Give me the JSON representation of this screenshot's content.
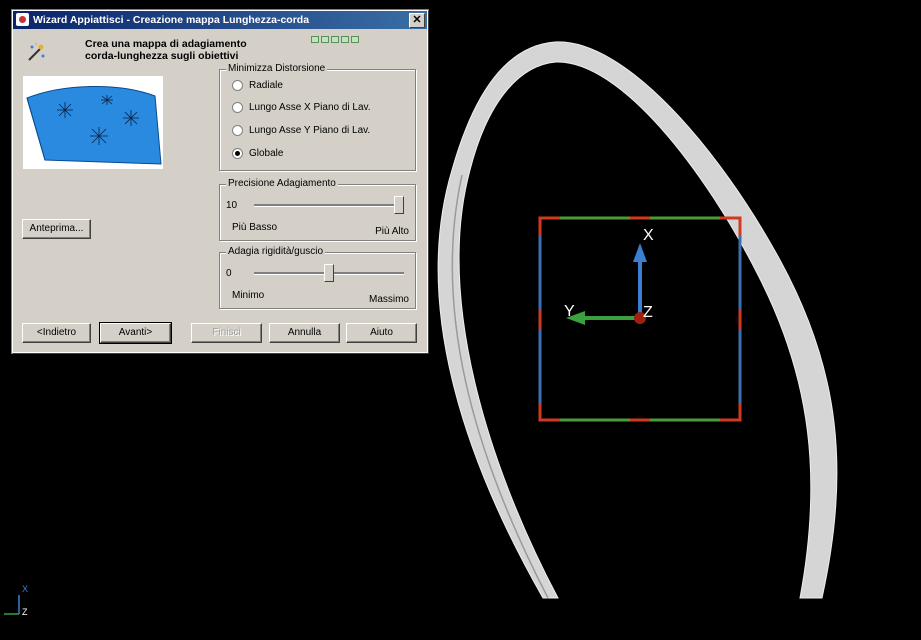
{
  "dialog": {
    "title": "Wizard Appiattisci - Creazione mappa Lunghezza-corda",
    "close_label": "✕",
    "header_line1": "Crea una mappa di adagiamento",
    "header_line2": "corda-lunghezza sugli obiettivi",
    "minimize_group": {
      "legend": "Minimizza Distorsione",
      "options": [
        "Radiale",
        "Lungo Asse X Piano di Lav.",
        "Lungo Asse Y Piano di Lav.",
        "Globale"
      ],
      "selected": "Globale"
    },
    "precision_group": {
      "legend": "Precisione Adagiamento",
      "value": "10",
      "min_label": "Più Basso",
      "max_label": "Più Alto",
      "level": 1.0
    },
    "rigidity_group": {
      "legend": "Adagia rigidità/guscio",
      "value": "0",
      "min_label": "Minimo",
      "max_label": "Massimo",
      "level": 0.5
    },
    "preview_button": "Anteprima...",
    "buttons": {
      "back": "<Indietro",
      "next": "Avanti>",
      "finish": "Finisci",
      "cancel": "Annulla",
      "help": "Aiuto"
    }
  },
  "viewport": {
    "gizmo_labels": {
      "x": "X",
      "y": "Y",
      "z": "Z"
    },
    "corner_axes": {
      "x": "X",
      "y": "Y",
      "z": "Z"
    },
    "colors": {
      "background": "#000000",
      "curve": "#d8d8d8",
      "box_red": "#d03a20",
      "box_green": "#4a9a3a",
      "box_blue": "#3b6fb0",
      "arrow_x": "#3b7fd0",
      "arrow_y": "#3aa040",
      "origin": "#a02010"
    }
  }
}
